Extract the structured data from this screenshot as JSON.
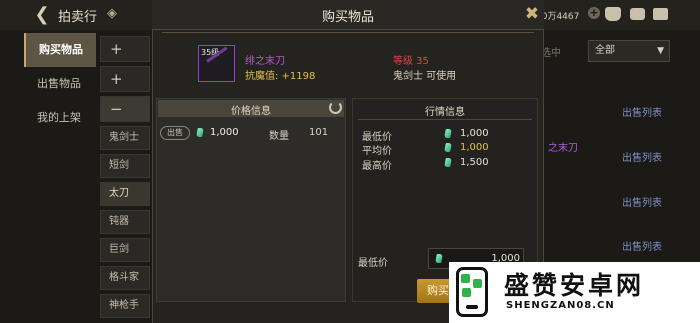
{
  "topbar": {
    "title": "拍卖行",
    "gold_amount": "00万4467"
  },
  "sidebar": {
    "items": [
      {
        "label": "购买物品",
        "active": true
      },
      {
        "label": "出售物品",
        "active": false
      },
      {
        "label": "我的上架",
        "active": false
      }
    ]
  },
  "categories": {
    "plus1": "+",
    "plus2": "+",
    "minus": "−",
    "items": [
      "鬼剑士",
      "短剑",
      "太刀",
      "钝器",
      "巨剑",
      "格斗家",
      "神枪手"
    ]
  },
  "background": {
    "filter_label": "选中",
    "filter_value": "全部",
    "sell_list_labels": [
      "出售列表",
      "出售列表",
      "出售列表",
      "出售列表",
      "出售列表"
    ],
    "item_name_fragment": "之末刀"
  },
  "modal": {
    "title": "购买物品",
    "item": {
      "level_badge": "35级",
      "name": "绯之末刀",
      "stat": "抗魔值: +1198",
      "required_level": "等级 35",
      "usable_class": "鬼剑士 可使用"
    },
    "price_info": {
      "title": "价格信息",
      "sell_tag": "出售",
      "price": "1,000",
      "qty_label": "数量",
      "qty": "101"
    },
    "market_info": {
      "title": "行情信息",
      "rows": [
        {
          "label": "最低价",
          "value": "1,000"
        },
        {
          "label": "平均价",
          "value": "1,000"
        },
        {
          "label": "最高价",
          "value": "1,500"
        }
      ]
    },
    "min_price_label": "最低价",
    "min_price_value": "1,000",
    "buy_button": "购买"
  },
  "watermark": {
    "title": "盛赞安卓网",
    "url": "SHENGZAN08.CN"
  },
  "colors": {
    "accent_gold": "#c9982d",
    "item_purple": "#c34fd9",
    "stat_yellow": "#e1c24d",
    "req_red": "#d94545"
  }
}
